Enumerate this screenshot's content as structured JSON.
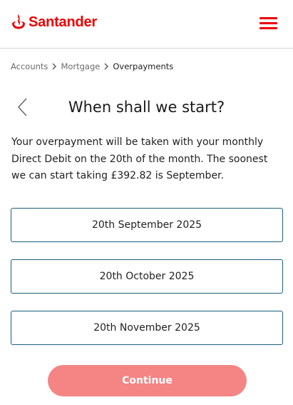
{
  "brand": {
    "name": "Santander",
    "logo_icon": "santander-flame-icon",
    "color": "#ec0000"
  },
  "header": {
    "menu_icon": "hamburger-menu-icon"
  },
  "breadcrumb": {
    "items": [
      "Accounts",
      "Mortgage",
      "Overpayments"
    ]
  },
  "page": {
    "back_icon": "chevron-left-icon",
    "title": "When shall we start?",
    "info_text": "Your overpayment will be taken with your monthly Direct Debit on the 20th of the month. The soonest we can start taking £392.82 is September."
  },
  "date_options": [
    "20th September 2025",
    "20th October 2025",
    "20th November 2025"
  ],
  "continue_button": {
    "label": "Continue",
    "color": "#f58585",
    "disabled": true
  }
}
